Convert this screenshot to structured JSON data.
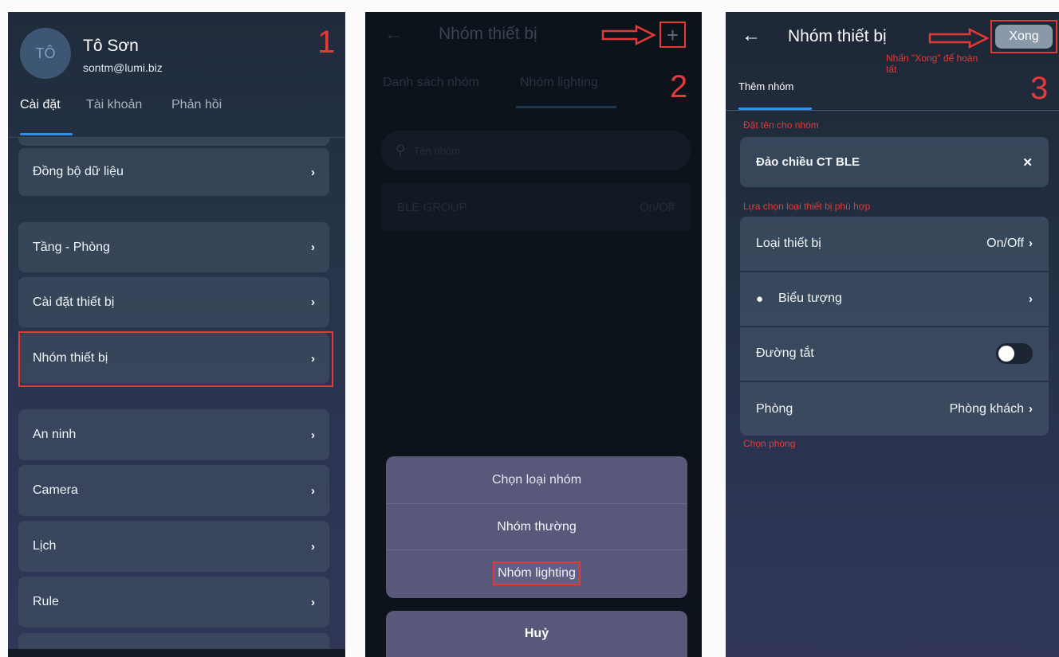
{
  "step_numbers": [
    "1",
    "2",
    "3"
  ],
  "screen1": {
    "avatar_initials": "TÔ",
    "user_name": "Tô Sơn",
    "user_email": "sontm@lumi.biz",
    "tabs": [
      "Cài đặt",
      "Tài khoản",
      "Phản hồi"
    ],
    "items": [
      "Đồng bộ dữ liệu",
      "Tầng - Phòng",
      "Cài đặt thiết bị",
      "Nhóm thiết bị",
      "An ninh",
      "Camera",
      "Lịch",
      "Rule"
    ],
    "highlighted_item": "Nhóm thiết bị",
    "chevron": "›"
  },
  "screen2": {
    "title": "Nhóm thiết bị",
    "plus": "+",
    "tabs": [
      "Danh sách nhóm",
      "Nhóm lighting"
    ],
    "search_placeholder": "Tên nhóm",
    "group_row": {
      "name": "BLE GROUP",
      "type": "On/Off"
    },
    "sheet_title": "Chọn loại nhóm",
    "option_normal": "Nhóm thường",
    "option_lighting": "Nhóm lighting",
    "cancel": "Huỷ"
  },
  "screen3": {
    "title": "Nhóm thiết bị",
    "done": "Xong",
    "annot_done": "Nhấn \"Xong\" để hoàn tất",
    "tab": "Thêm nhóm",
    "annot_name": "Đặt tên cho nhóm",
    "group_name": "Đảo chiều CT BLE",
    "clear": "✕",
    "annot_type": "Lựa chọn loại thiết bị phù hợp",
    "device_type_label": "Loại thiết bị",
    "device_type_value": "On/Off",
    "icon_label": "Biểu tượng",
    "shortcut_label": "Đường tắt",
    "room_label": "Phòng",
    "room_value": "Phòng khách",
    "annot_room": "Chọn phòng"
  },
  "colors": {
    "highlight": "#e53935",
    "accent": "#2f8ff0"
  }
}
